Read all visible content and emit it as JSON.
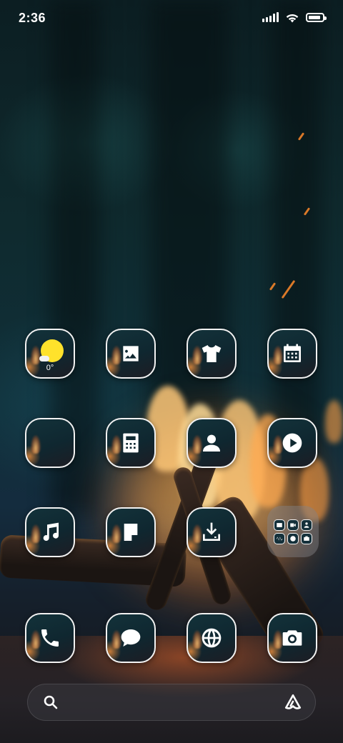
{
  "status_bar": {
    "time": "2:36",
    "signal_icon": "signal-bars-icon",
    "wifi_icon": "wifi-icon",
    "battery_icon": "battery-icon",
    "battery_level": 0.9
  },
  "home_screen": {
    "weather_widget": {
      "temperature": "0°",
      "icon": "sun-cloud-icon",
      "sun_color": "#ffe22b"
    },
    "apps": [
      {
        "icon": "gallery-icon"
      },
      {
        "icon": "theme-shirt-icon"
      },
      {
        "icon": "calendar-icon"
      },
      {
        "icon": "browser-placeholder-icon"
      },
      {
        "icon": "calculator-icon"
      },
      {
        "icon": "contacts-icon"
      },
      {
        "icon": "video-play-icon"
      },
      {
        "icon": "music-icon"
      },
      {
        "icon": "notes-icon"
      },
      {
        "icon": "download-icon"
      },
      {
        "icon": "phone-icon"
      },
      {
        "icon": "messages-icon"
      },
      {
        "icon": "globe-icon"
      },
      {
        "icon": "camera-icon"
      }
    ],
    "folder": {
      "icon": "app-folder-icon",
      "mini_icons": 6
    }
  },
  "search_bar": {
    "left_icon": "search-icon",
    "right_icon": "assistant-icon"
  },
  "colors": {
    "icon_border": "#f2f2f2",
    "icon_bg": "#13323a",
    "accent_sun": "#ffe22b"
  }
}
